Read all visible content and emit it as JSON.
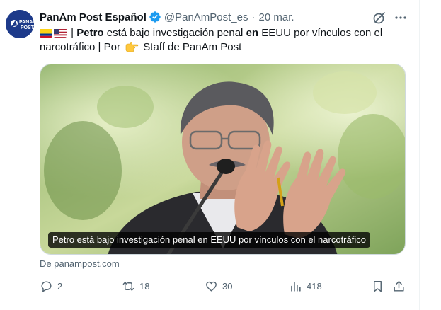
{
  "tweet": {
    "display_name": "PanAm Post Español",
    "handle": "@PanAmPost_es",
    "separator": "·",
    "date": "20 mar.",
    "avatar_icon": "panam-post-logo",
    "avatar_text": "PANAM POST",
    "text": {
      "flags": [
        "colombia-flag",
        "usa-flag"
      ],
      "pipe1": " | ",
      "bold1": "Petro",
      "mid1": " está bajo investigación penal ",
      "bold2": "en",
      "mid2": " EEUU por vínculos con el narcotráfico | Por ",
      "emoji": "pointing-right-hand",
      "tail": " Staff de PanAm Post"
    },
    "media": {
      "caption": "Petro está bajo investigación penal en EEUU por vínculos con el narcotráfico"
    },
    "source": "De panampost.com",
    "actions": {
      "replies": "2",
      "retweets": "18",
      "likes": "30",
      "views": "418"
    }
  },
  "colors": {
    "text": "#0f1419",
    "secondary": "#536471",
    "verified": "#1d9bf0",
    "avatar_bg": "#1d3a8a"
  }
}
